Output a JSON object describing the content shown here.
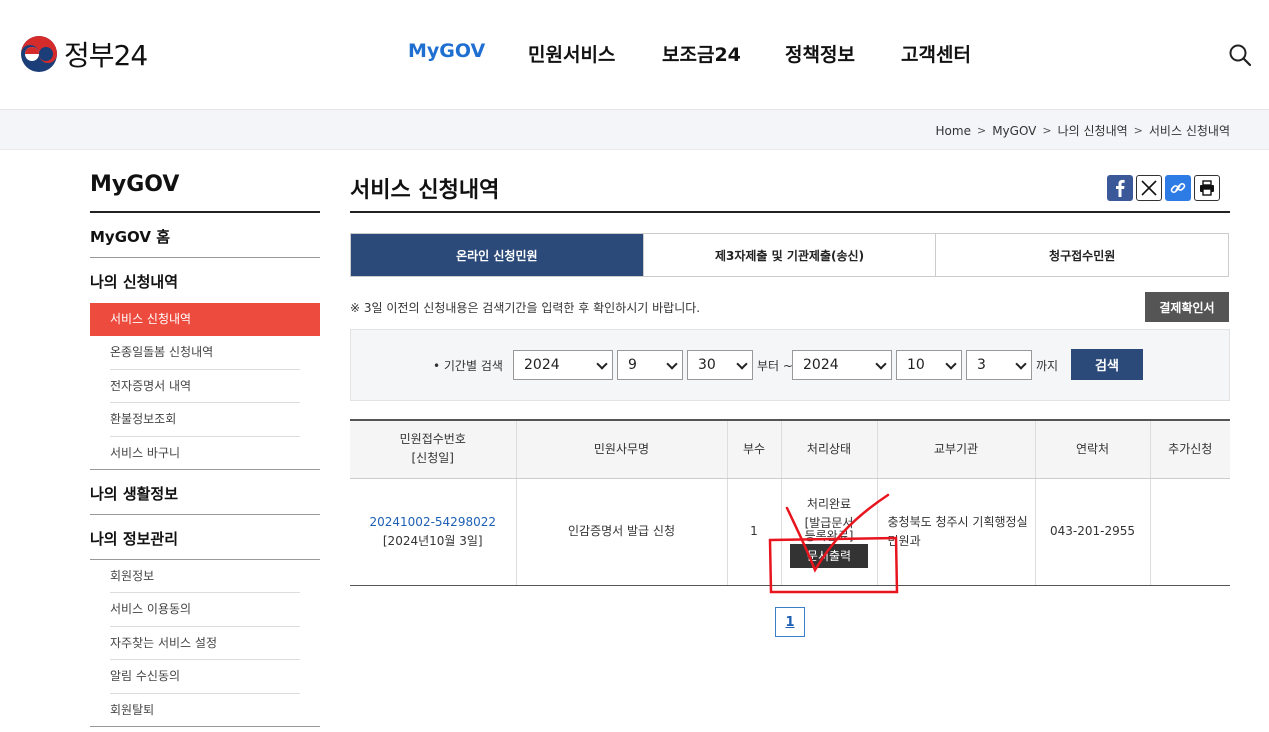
{
  "header": {
    "logo_text": "정부24",
    "nav": [
      "MyGOV",
      "민원서비스",
      "보조금24",
      "정책정보",
      "고객센터"
    ],
    "nav_active": "MyGOV",
    "search_icon": "search-icon"
  },
  "breadcrumb": [
    "Home",
    "MyGOV",
    "나의 신청내역",
    "서비스 신청내역"
  ],
  "sidebar": {
    "title": "MyGOV",
    "home": "MyGOV 홈",
    "group1": {
      "label": "나의 신청내역",
      "items": [
        "서비스 신청내역",
        "온종일돌봄 신청내역",
        "전자증명서 내역",
        "환불정보조회",
        "서비스 바구니"
      ]
    },
    "group2": {
      "label": "나의 생활정보"
    },
    "group3": {
      "label": "나의 정보관리",
      "items": [
        "회원정보",
        "서비스 이용동의",
        "자주찾는 서비스 설정",
        "알림 수신동의",
        "회원탈퇴"
      ]
    }
  },
  "main": {
    "title": "서비스 신청내역",
    "share_icons": [
      "facebook-icon",
      "x-icon",
      "link-icon",
      "print-icon"
    ],
    "tabs": [
      "온라인 신청민원",
      "제3자제출 및 기관제출(송신)",
      "청구접수민원"
    ],
    "active_tab": "온라인 신청민원",
    "notice": "※ 3일 이전의 신청내용은 검색기간을 입력한 후 확인하시기 바랍니다.",
    "receipt_button": "결제확인서",
    "search": {
      "label": "• 기간별 검색",
      "from_year": "2024",
      "from_month": "9",
      "from_day": "30",
      "from_text": "부터 ~",
      "to_year": "2024",
      "to_month": "10",
      "to_day": "3",
      "to_text": "까지",
      "button": "검색"
    },
    "table": {
      "headers": {
        "receipt_no": "민원접수번호",
        "request_date": "[신청일]",
        "name": "민원사무명",
        "copies": "부수",
        "status": "처리상태",
        "agency": "교부기관",
        "contact": "연락처",
        "extra": "추가신청"
      },
      "rows": [
        {
          "receipt_no": "20241002-54298022",
          "request_date": "[2024년10월 3일]",
          "name": "인감증명서 발급 신청",
          "copies": "1",
          "status_line1": "처리완료",
          "status_line2": "[발급문서",
          "status_line3": "등록완료]",
          "print_button": "문서출력",
          "agency": "충청북도 청주시 기획행정실 민원과",
          "contact": "043-201-2955",
          "extra": ""
        }
      ]
    },
    "pagination": [
      "1"
    ],
    "annotation_color": "#e8141e"
  }
}
